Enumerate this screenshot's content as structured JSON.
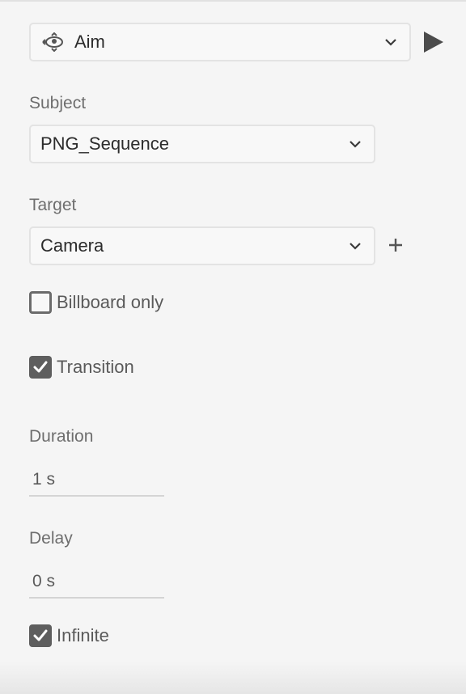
{
  "behavior": {
    "selected": "Aim",
    "icon": "aim-eye-icon",
    "play_icon": "play-icon"
  },
  "subject": {
    "label": "Subject",
    "value": "PNG_Sequence"
  },
  "target": {
    "label": "Target",
    "value": "Camera",
    "add_icon": "plus-icon"
  },
  "billboard_only": {
    "label": "Billboard only",
    "checked": false
  },
  "transition": {
    "label": "Transition",
    "checked": true
  },
  "duration": {
    "label": "Duration",
    "value": "1 s"
  },
  "delay": {
    "label": "Delay",
    "value": "0 s"
  },
  "infinite": {
    "label": "Infinite",
    "checked": true
  },
  "colors": {
    "background": "#f5f5f5",
    "checkbox_fill": "#5e5e5e",
    "play": "#4b4b4b"
  }
}
